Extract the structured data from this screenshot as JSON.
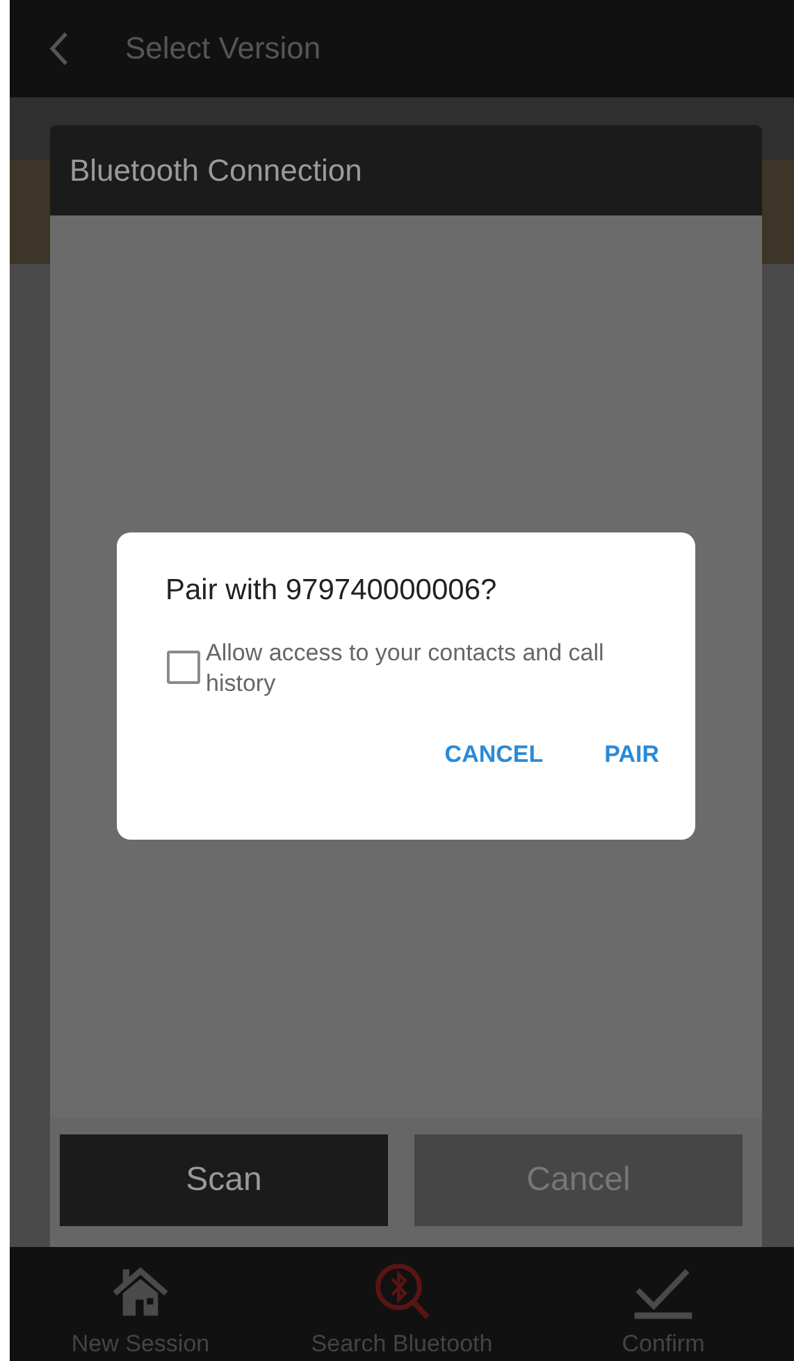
{
  "app_bar": {
    "title": "Select Version"
  },
  "bluetooth_dialog": {
    "title": "Bluetooth Connection",
    "buttons": [
      {
        "label": "Scan",
        "disabled": false
      },
      {
        "label": "Cancel",
        "disabled": true
      }
    ]
  },
  "pair_dialog": {
    "title": "Pair with 979740000006?",
    "checkbox": {
      "label": "Allow access to your contacts and call history",
      "checked": false
    },
    "buttons": [
      {
        "label": "CANCEL"
      },
      {
        "label": "PAIR"
      }
    ]
  },
  "bottom_nav": [
    {
      "label": "New Session",
      "selected": false
    },
    {
      "label": "Search Bluetooth",
      "selected": true
    },
    {
      "label": "Confirm",
      "selected": false
    }
  ]
}
